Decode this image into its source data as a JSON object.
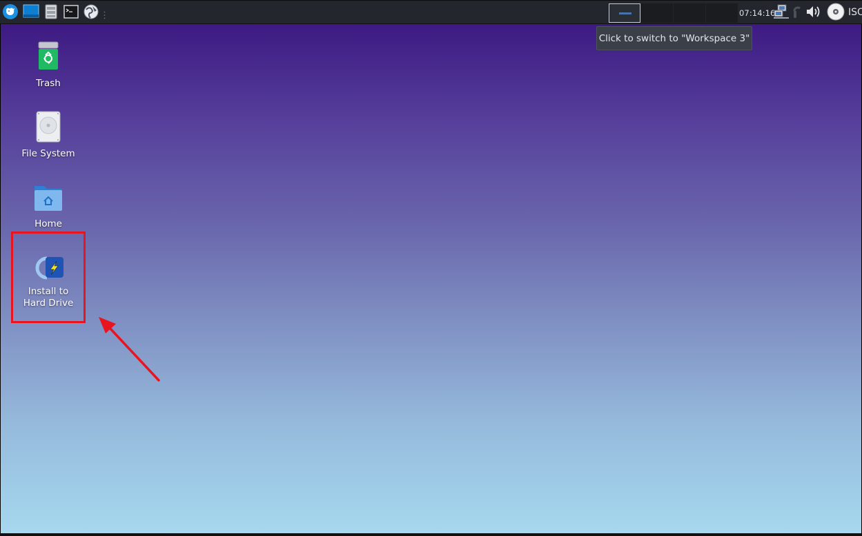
{
  "panel": {
    "launchers": [
      {
        "name": "whisker-menu-icon",
        "label": ""
      },
      {
        "name": "show-desktop-icon",
        "label": ""
      },
      {
        "name": "file-manager-icon",
        "label": ""
      },
      {
        "name": "terminal-icon",
        "label": ""
      },
      {
        "name": "web-browser-icon",
        "label": ""
      }
    ],
    "workspaces": [
      "Workspace 1",
      "Workspace 2",
      "Workspace 3",
      "Workspace 4"
    ],
    "active_workspace_index": 0,
    "clock": "07:14:16",
    "tray_icons": [
      "network-icon",
      "updates-icon",
      "volume-icon",
      "optical-disc-icon"
    ],
    "iso_label": "ISO"
  },
  "tooltip": {
    "text": "Click to switch to \"Workspace 3\""
  },
  "desktop": {
    "icons": [
      {
        "label": "Trash",
        "icon": "trash-icon"
      },
      {
        "label": "File System",
        "icon": "harddisk-icon"
      },
      {
        "label": "Home",
        "icon": "home-folder-icon"
      },
      {
        "label_line1": "Install to",
        "label_line2": "Hard Drive",
        "icon": "installer-icon"
      }
    ]
  },
  "annotation": {
    "box_color": "#e8141f",
    "arrow_color": "#e8141f"
  },
  "colors": {
    "panel_bg": "#23262c",
    "desktop_top": "#3d1a82",
    "desktop_bottom": "#a6d8ef"
  }
}
